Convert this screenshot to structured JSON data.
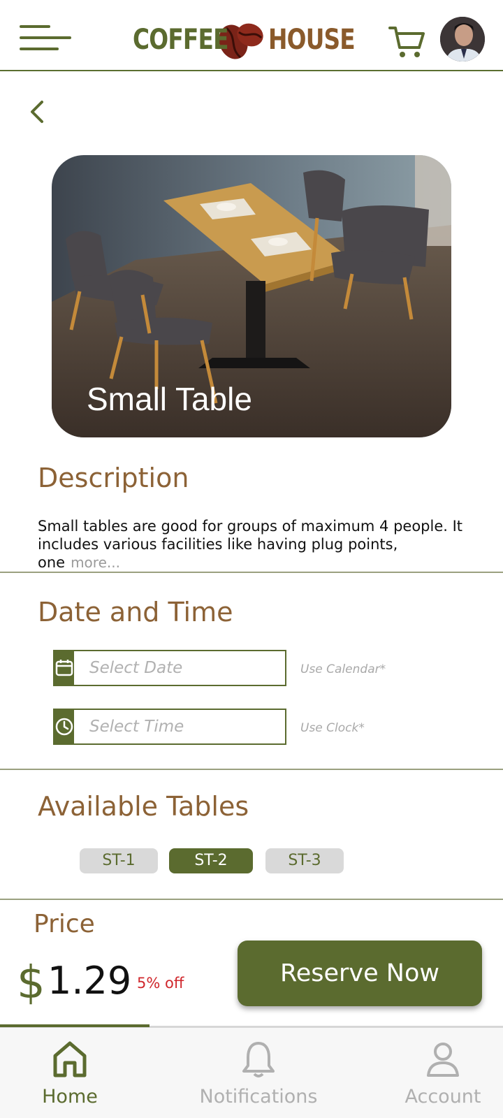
{
  "header": {
    "brand_left": "COFFEE",
    "brand_right": "HOUSE",
    "brand_colors": {
      "green": "#5b6b2f",
      "brown": "#8a5a2b"
    }
  },
  "hero": {
    "title": "Small Table"
  },
  "description": {
    "heading": "Description",
    "text": "Small tables are good for groups of maximum 4 people. It includes various facilities like having plug points, one",
    "more": "more..."
  },
  "datetime": {
    "heading": "Date and Time",
    "date_placeholder": "Select Date",
    "date_hint": "Use Calendar*",
    "time_placeholder": "Select Time",
    "time_hint": "Use Clock*"
  },
  "tables": {
    "heading": "Available Tables",
    "items": [
      {
        "label": "ST-1",
        "selected": false
      },
      {
        "label": "ST-2",
        "selected": true
      },
      {
        "label": "ST-3",
        "selected": false
      }
    ]
  },
  "price": {
    "label": "Price",
    "currency": "$",
    "amount": "1.29",
    "discount": "5% off"
  },
  "cta": {
    "reserve_label": "Reserve Now"
  },
  "nav": {
    "items": [
      {
        "label": "Home",
        "icon": "home-icon",
        "active": true
      },
      {
        "label": "Notifications",
        "icon": "bell-icon",
        "active": false
      },
      {
        "label": "Account",
        "icon": "user-icon",
        "active": false
      }
    ]
  },
  "colors": {
    "accent": "#5b6b2f",
    "heading": "#8c6236",
    "discount": "#d0272c"
  }
}
